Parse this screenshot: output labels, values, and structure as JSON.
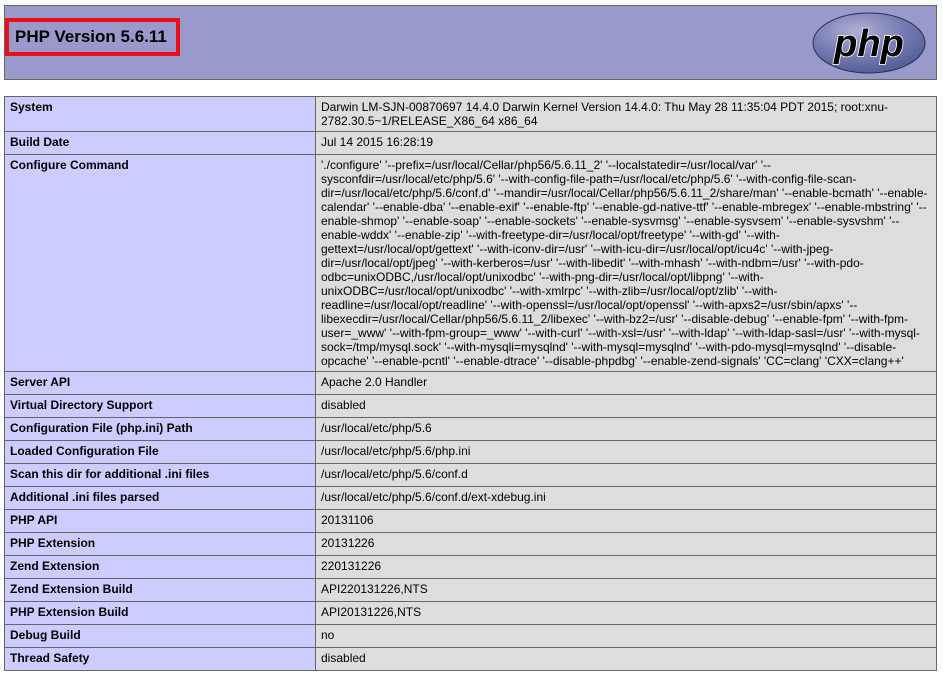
{
  "header": {
    "title": "PHP Version 5.6.11",
    "logo_text": "php",
    "colors": {
      "header_bg": "#9999cc",
      "highlight_border": "#e8101a",
      "label_cell_bg": "#ccccff",
      "value_cell_bg": "#dddddd",
      "logo_bg": "#6c71a8",
      "logo_text": "#000000"
    }
  },
  "rows": [
    {
      "label": "System",
      "value": "Darwin LM-SJN-00870697 14.4.0 Darwin Kernel Version 14.4.0: Thu May 28 11:35:04 PDT 2015; root:xnu-2782.30.5~1/RELEASE_X86_64 x86_64"
    },
    {
      "label": "Build Date",
      "value": "Jul 14 2015 16:28:19"
    },
    {
      "label": "Configure Command",
      "value": "'./configure' '--prefix=/usr/local/Cellar/php56/5.6.11_2' '--localstatedir=/usr/local/var' '--sysconfdir=/usr/local/etc/php/5.6' '--with-config-file-path=/usr/local/etc/php/5.6' '--with-config-file-scan-dir=/usr/local/etc/php/5.6/conf.d' '--mandir=/usr/local/Cellar/php56/5.6.11_2/share/man' '--enable-bcmath' '--enable-calendar' '--enable-dba' '--enable-exif' '--enable-ftp' '--enable-gd-native-ttf' '--enable-mbregex' '--enable-mbstring' '--enable-shmop' '--enable-soap' '--enable-sockets' '--enable-sysvmsg' '--enable-sysvsem' '--enable-sysvshm' '--enable-wddx' '--enable-zip' '--with-freetype-dir=/usr/local/opt/freetype' '--with-gd' '--with-gettext=/usr/local/opt/gettext' '--with-iconv-dir=/usr' '--with-icu-dir=/usr/local/opt/icu4c' '--with-jpeg-dir=/usr/local/opt/jpeg' '--with-kerberos=/usr' '--with-libedit' '--with-mhash' '--with-ndbm=/usr' '--with-pdo-odbc=unixODBC,/usr/local/opt/unixodbc' '--with-png-dir=/usr/local/opt/libpng' '--with-unixODBC=/usr/local/opt/unixodbc' '--with-xmlrpc' '--with-zlib=/usr/local/opt/zlib' '--with-readline=/usr/local/opt/readline' '--with-openssl=/usr/local/opt/openssl' '--with-apxs2=/usr/sbin/apxs' '--libexecdir=/usr/local/Cellar/php56/5.6.11_2/libexec' '--with-bz2=/usr' '--disable-debug' '--enable-fpm' '--with-fpm-user=_www' '--with-fpm-group=_www' '--with-curl' '--with-xsl=/usr' '--with-ldap' '--with-ldap-sasl=/usr' '--with-mysql-sock=/tmp/mysql.sock' '--with-mysqli=mysqlnd' '--with-mysql=mysqlnd' '--with-pdo-mysql=mysqlnd' '--disable-opcache' '--enable-pcntl' '--enable-dtrace' '--disable-phpdbg' '--enable-zend-signals' 'CC=clang' 'CXX=clang++'"
    },
    {
      "label": "Server API",
      "value": "Apache 2.0 Handler"
    },
    {
      "label": "Virtual Directory Support",
      "value": "disabled"
    },
    {
      "label": "Configuration File (php.ini) Path",
      "value": "/usr/local/etc/php/5.6"
    },
    {
      "label": "Loaded Configuration File",
      "value": "/usr/local/etc/php/5.6/php.ini"
    },
    {
      "label": "Scan this dir for additional .ini files",
      "value": "/usr/local/etc/php/5.6/conf.d"
    },
    {
      "label": "Additional .ini files parsed",
      "value": "/usr/local/etc/php/5.6/conf.d/ext-xdebug.ini"
    },
    {
      "label": "PHP API",
      "value": "20131106"
    },
    {
      "label": "PHP Extension",
      "value": "20131226"
    },
    {
      "label": "Zend Extension",
      "value": "220131226"
    },
    {
      "label": "Zend Extension Build",
      "value": "API220131226,NTS"
    },
    {
      "label": "PHP Extension Build",
      "value": "API20131226,NTS"
    },
    {
      "label": "Debug Build",
      "value": "no"
    },
    {
      "label": "Thread Safety",
      "value": "disabled"
    }
  ]
}
